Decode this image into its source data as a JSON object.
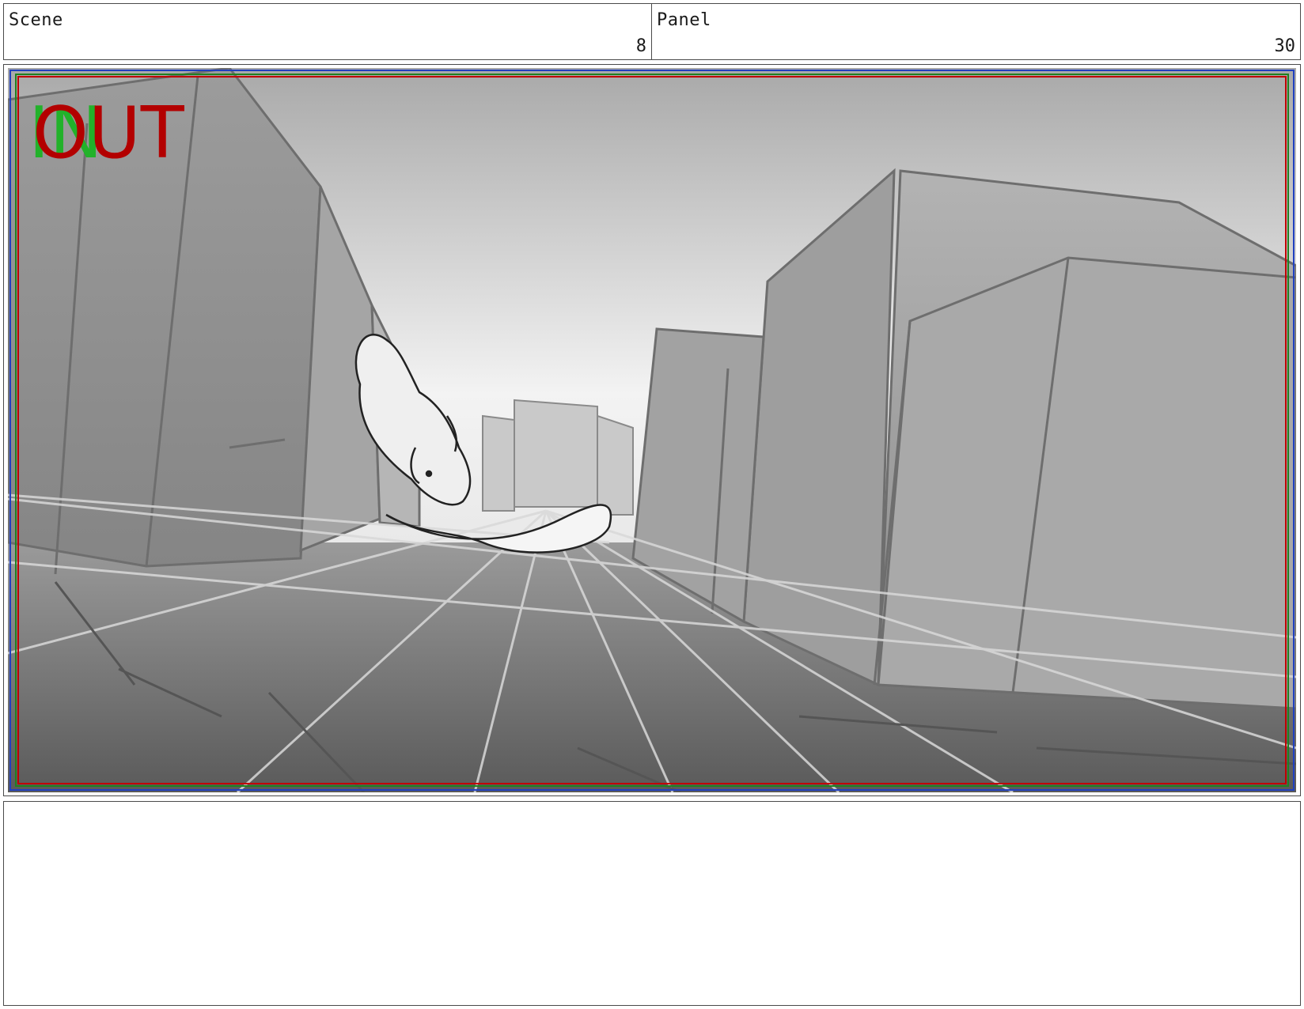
{
  "header": {
    "scene_label": "Scene",
    "scene_value": "8",
    "panel_label": "Panel",
    "panel_value": "30"
  },
  "frame": {
    "in_marker": "IN",
    "out_marker": "OUT",
    "in_color": "#22b22a",
    "out_color": "#b30000",
    "safe_frame_colors": [
      "#c00000",
      "#208020",
      "#2040c0"
    ]
  },
  "notes": {
    "text": ""
  }
}
